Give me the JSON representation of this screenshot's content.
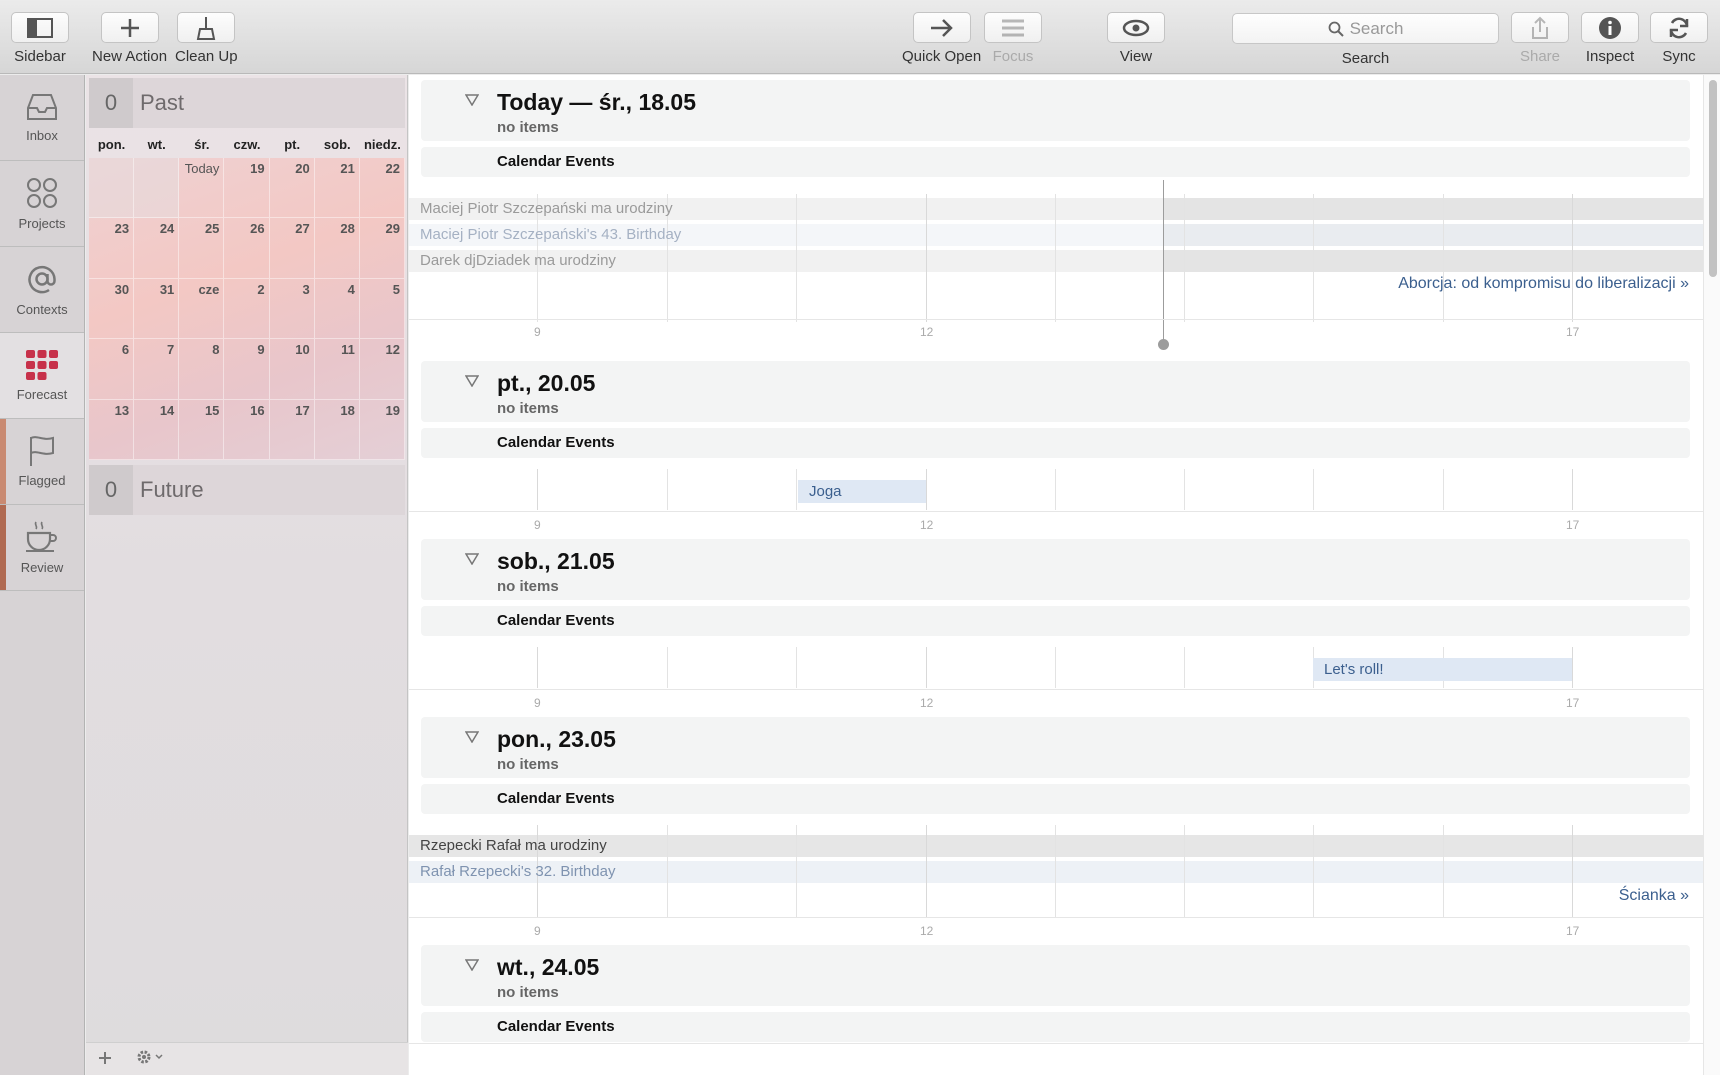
{
  "toolbar": {
    "sidebar": "Sidebar",
    "new_action": "New Action",
    "clean_up": "Clean Up",
    "quick_open": "Quick Open",
    "focus": "Focus",
    "view": "View",
    "search_placeholder": "Search",
    "search_label": "Search",
    "share": "Share",
    "inspect": "Inspect",
    "sync": "Sync"
  },
  "perspectives": [
    "Inbox",
    "Projects",
    "Contexts",
    "Forecast",
    "Flagged",
    "Review"
  ],
  "calendar": {
    "past": {
      "count": "0",
      "label": "Past"
    },
    "future": {
      "count": "0",
      "label": "Future"
    },
    "weekdays": [
      "pon.",
      "wt.",
      "śr.",
      "czw.",
      "pt.",
      "sob.",
      "niedz."
    ],
    "rows": [
      [
        "",
        "",
        "Today",
        "19",
        "20",
        "21",
        "22"
      ],
      [
        "23",
        "24",
        "25",
        "26",
        "27",
        "28",
        "29"
      ],
      [
        "30",
        "31",
        "cze",
        "2",
        "3",
        "4",
        "5"
      ],
      [
        "6",
        "7",
        "8",
        "9",
        "10",
        "11",
        "12"
      ],
      [
        "13",
        "14",
        "15",
        "16",
        "17",
        "18",
        "19"
      ]
    ]
  },
  "days": [
    {
      "title": "Today — śr., 18.05",
      "sub": "no items",
      "cal": "Calendar Events",
      "events": [
        "Maciej Piotr Szczepański ma urodziny",
        "Maciej Piotr Szczepański's 43. Birthday",
        "Darek djDziadek ma urodziny"
      ],
      "overflow": "Aborcja: od kompromisu do liberalizacji »",
      "ticks": [
        "9",
        "12",
        "17"
      ]
    },
    {
      "title": "pt., 20.05",
      "sub": "no items",
      "cal": "Calendar Events",
      "event": "Joga",
      "ticks": [
        "9",
        "12",
        "17"
      ]
    },
    {
      "title": "sob., 21.05",
      "sub": "no items",
      "cal": "Calendar Events",
      "event": "Let's roll!",
      "ticks": [
        "9",
        "12",
        "17"
      ]
    },
    {
      "title": "pon., 23.05",
      "sub": "no items",
      "cal": "Calendar Events",
      "events": [
        "Rzepecki Rafał ma urodziny",
        "Rafał Rzepecki's 32. Birthday"
      ],
      "overflow": "Ścianka »",
      "ticks": [
        "9",
        "12",
        "17"
      ]
    },
    {
      "title": "wt., 24.05",
      "sub": "no items",
      "cal": "Calendar Events"
    }
  ],
  "colors": {
    "accent": "#3b5f8e",
    "forecast_icon": "#c7314a",
    "flagged_stripe": "#c98a72",
    "review_stripe": "#b06a52"
  },
  "icons": {
    "sidebar": "sidebar-icon",
    "new_action": "plus-icon",
    "clean_up": "broom-icon",
    "quick_open": "arrow-right-icon",
    "focus": "list-icon",
    "view": "eye-icon",
    "search": "magnifier-icon",
    "share": "share-icon",
    "inspect": "info-icon",
    "sync": "sync-icon",
    "settings": "gear-icon",
    "add": "plus-icon"
  }
}
